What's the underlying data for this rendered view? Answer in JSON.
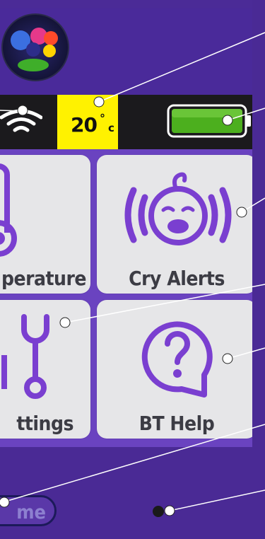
{
  "status": {
    "temperature_value": "20",
    "temperature_unit_deg": "°",
    "temperature_unit_c": "c"
  },
  "tiles": {
    "temperature_label": "perature",
    "cry_alerts_label": "Cry Alerts",
    "settings_label": "ttings",
    "help_label": "BT Help"
  },
  "nav": {
    "home_label": "me"
  },
  "colors": {
    "accent_purple": "#6a43c0",
    "icon_purple": "#7a3fd0",
    "temp_highlight": "#fff200",
    "battery_green": "#4caf1e",
    "status_bar_bg": "#1b1a1d"
  },
  "icons": [
    "bt-logo-icon",
    "wifi-icon",
    "battery-icon",
    "thermometer-icon",
    "baby-face-icon",
    "wrench-icon",
    "question-icon"
  ]
}
